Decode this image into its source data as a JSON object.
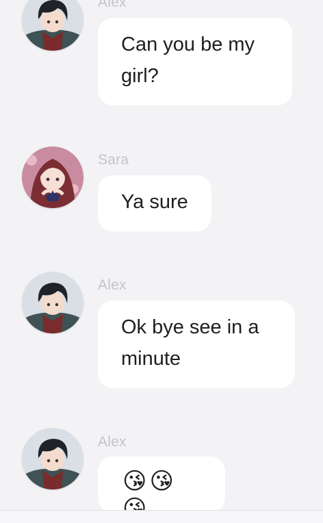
{
  "messages": [
    {
      "sender": "Alex",
      "avatar_icon": "boy-avatar-icon",
      "text": "Can you be my girl?"
    },
    {
      "sender": "Sara",
      "avatar_icon": "girl-avatar-icon",
      "text": "Ya sure"
    },
    {
      "sender": "Alex",
      "avatar_icon": "boy-avatar-icon",
      "text": "Ok bye see in a minute"
    },
    {
      "sender": "Alex",
      "avatar_icon": "boy-avatar-icon",
      "text": "😘😘😘"
    }
  ],
  "colors": {
    "background": "#f3f3f5",
    "bubble": "#ffffff",
    "sender_name": "#c4c4c8",
    "message_text": "#1e1e22"
  }
}
